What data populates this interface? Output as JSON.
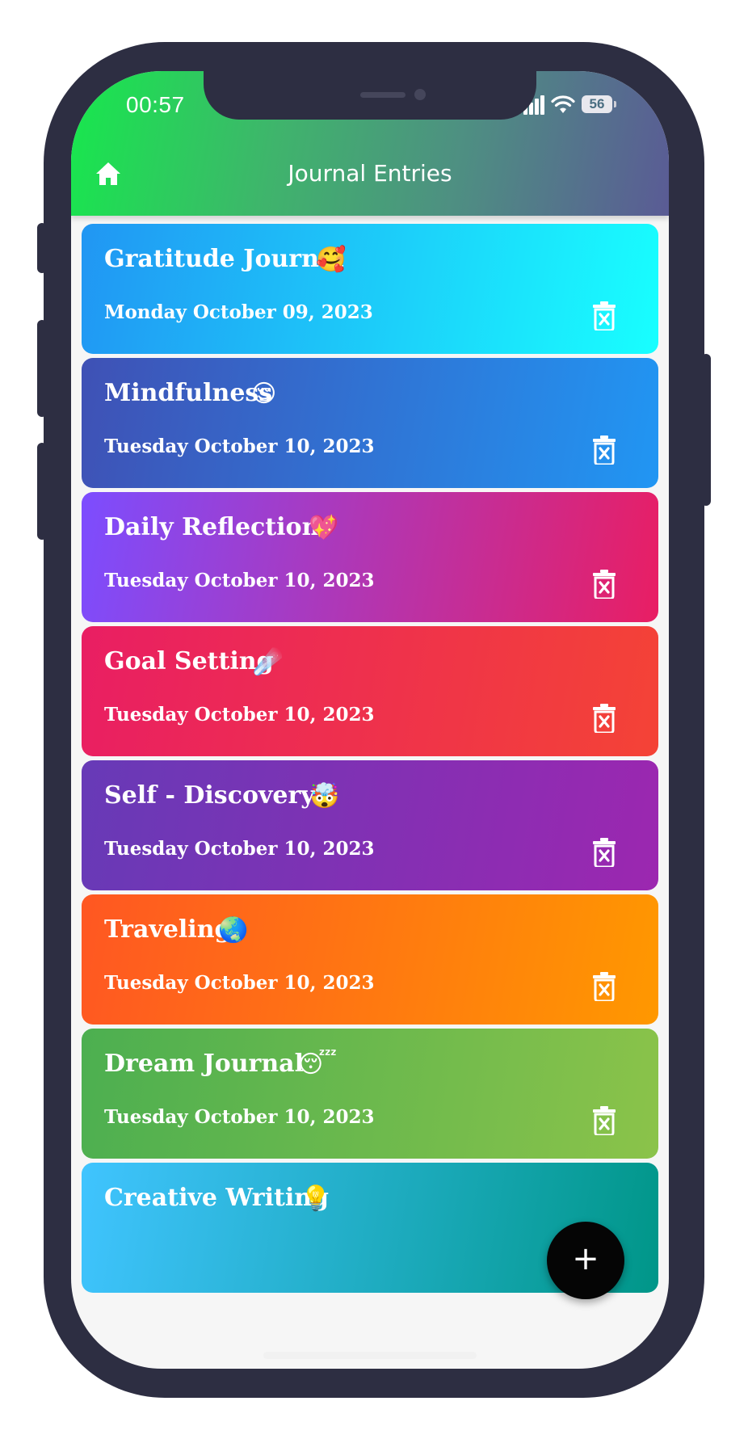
{
  "status_bar": {
    "time": "00:57",
    "battery": "56",
    "icons": [
      "signal-icon",
      "wifi-icon",
      "battery-icon"
    ]
  },
  "header": {
    "title": "Journal Entries",
    "home_icon": "home-icon",
    "gradient": [
      "#17e84d",
      "#5a5b95"
    ]
  },
  "entries": [
    {
      "title": "Gratitude Journal",
      "emoji": "🥰",
      "date": "Monday October 09, 2023",
      "colors": [
        "#2196f3",
        "#18ffff"
      ]
    },
    {
      "title": "Mindfulness",
      "emoji": "😌",
      "date": "Tuesday October 10, 2023",
      "colors": [
        "#3f51b5",
        "#2196f3"
      ]
    },
    {
      "title": "Daily Reflection",
      "emoji": "💖",
      "date": "Tuesday October 10, 2023",
      "colors": [
        "#7c4dff",
        "#e91e63"
      ]
    },
    {
      "title": "Goal Setting",
      "emoji": "☄️",
      "date": "Tuesday October 10, 2023",
      "colors": [
        "#e91e63",
        "#f44336"
      ]
    },
    {
      "title": "Self - Discovery",
      "emoji": "🤯",
      "date": "Tuesday October 10, 2023",
      "colors": [
        "#673ab7",
        "#9c27b0"
      ]
    },
    {
      "title": "Traveling",
      "emoji": "🌏",
      "date": "Tuesday October 10, 2023",
      "colors": [
        "#ff5722",
        "#ff9800"
      ]
    },
    {
      "title": "Dream Journal",
      "emoji": "😴",
      "date": "Tuesday October 10, 2023",
      "colors": [
        "#4caf50",
        "#8bc34a"
      ]
    },
    {
      "title": "Creative Writing",
      "emoji": "💡",
      "date": "",
      "colors": [
        "#40c4ff",
        "#009688"
      ]
    }
  ],
  "fab": {
    "label": "+",
    "icon": "plus-icon"
  }
}
